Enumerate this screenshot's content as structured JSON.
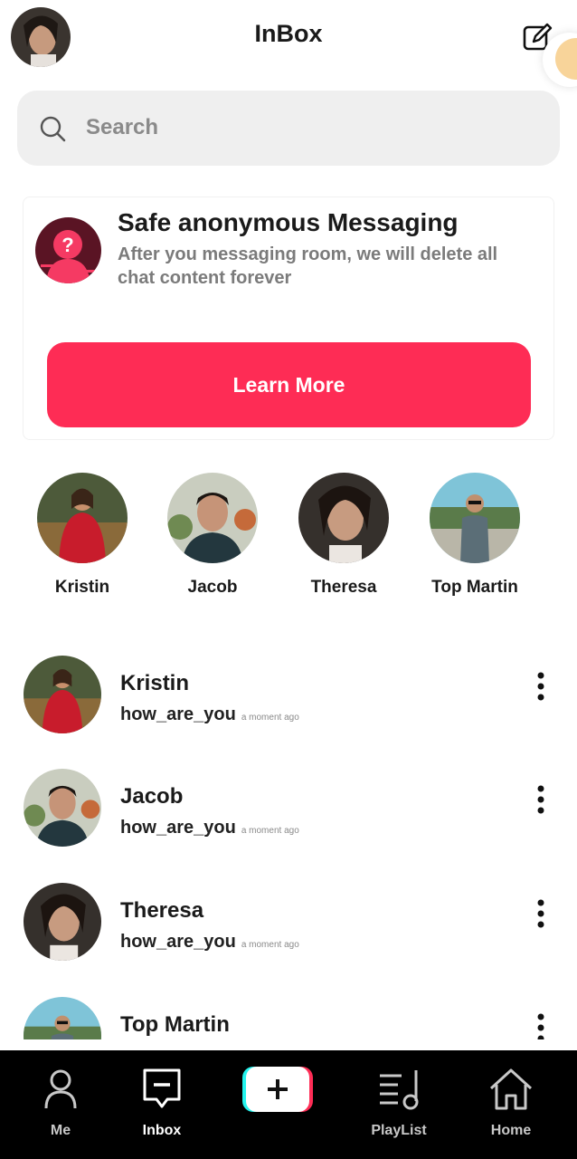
{
  "header": {
    "title": "InBox"
  },
  "search": {
    "placeholder": "Search"
  },
  "promo": {
    "title": "Safe anonymous Messaging",
    "text": "After you messaging room, we will delete all chat content forever",
    "button_label": "Learn More"
  },
  "stories": [
    {
      "name": "Kristin"
    },
    {
      "name": "Jacob"
    },
    {
      "name": "Theresa"
    },
    {
      "name": "Top Martin"
    }
  ],
  "chats": [
    {
      "name": "Kristin",
      "message": "how_are_you",
      "time": "a moment ago"
    },
    {
      "name": "Jacob",
      "message": "how_are_you",
      "time": "a moment ago"
    },
    {
      "name": "Theresa",
      "message": "how_are_you",
      "time": "a moment ago"
    },
    {
      "name": "Top Martin",
      "message": "",
      "time": ""
    }
  ],
  "nav": {
    "me": "Me",
    "inbox": "Inbox",
    "playlist": "PlayList",
    "home": "Home"
  },
  "colors": {
    "accent": "#fe2c55",
    "nav_bg": "#000000",
    "search_bg": "#efefef"
  }
}
